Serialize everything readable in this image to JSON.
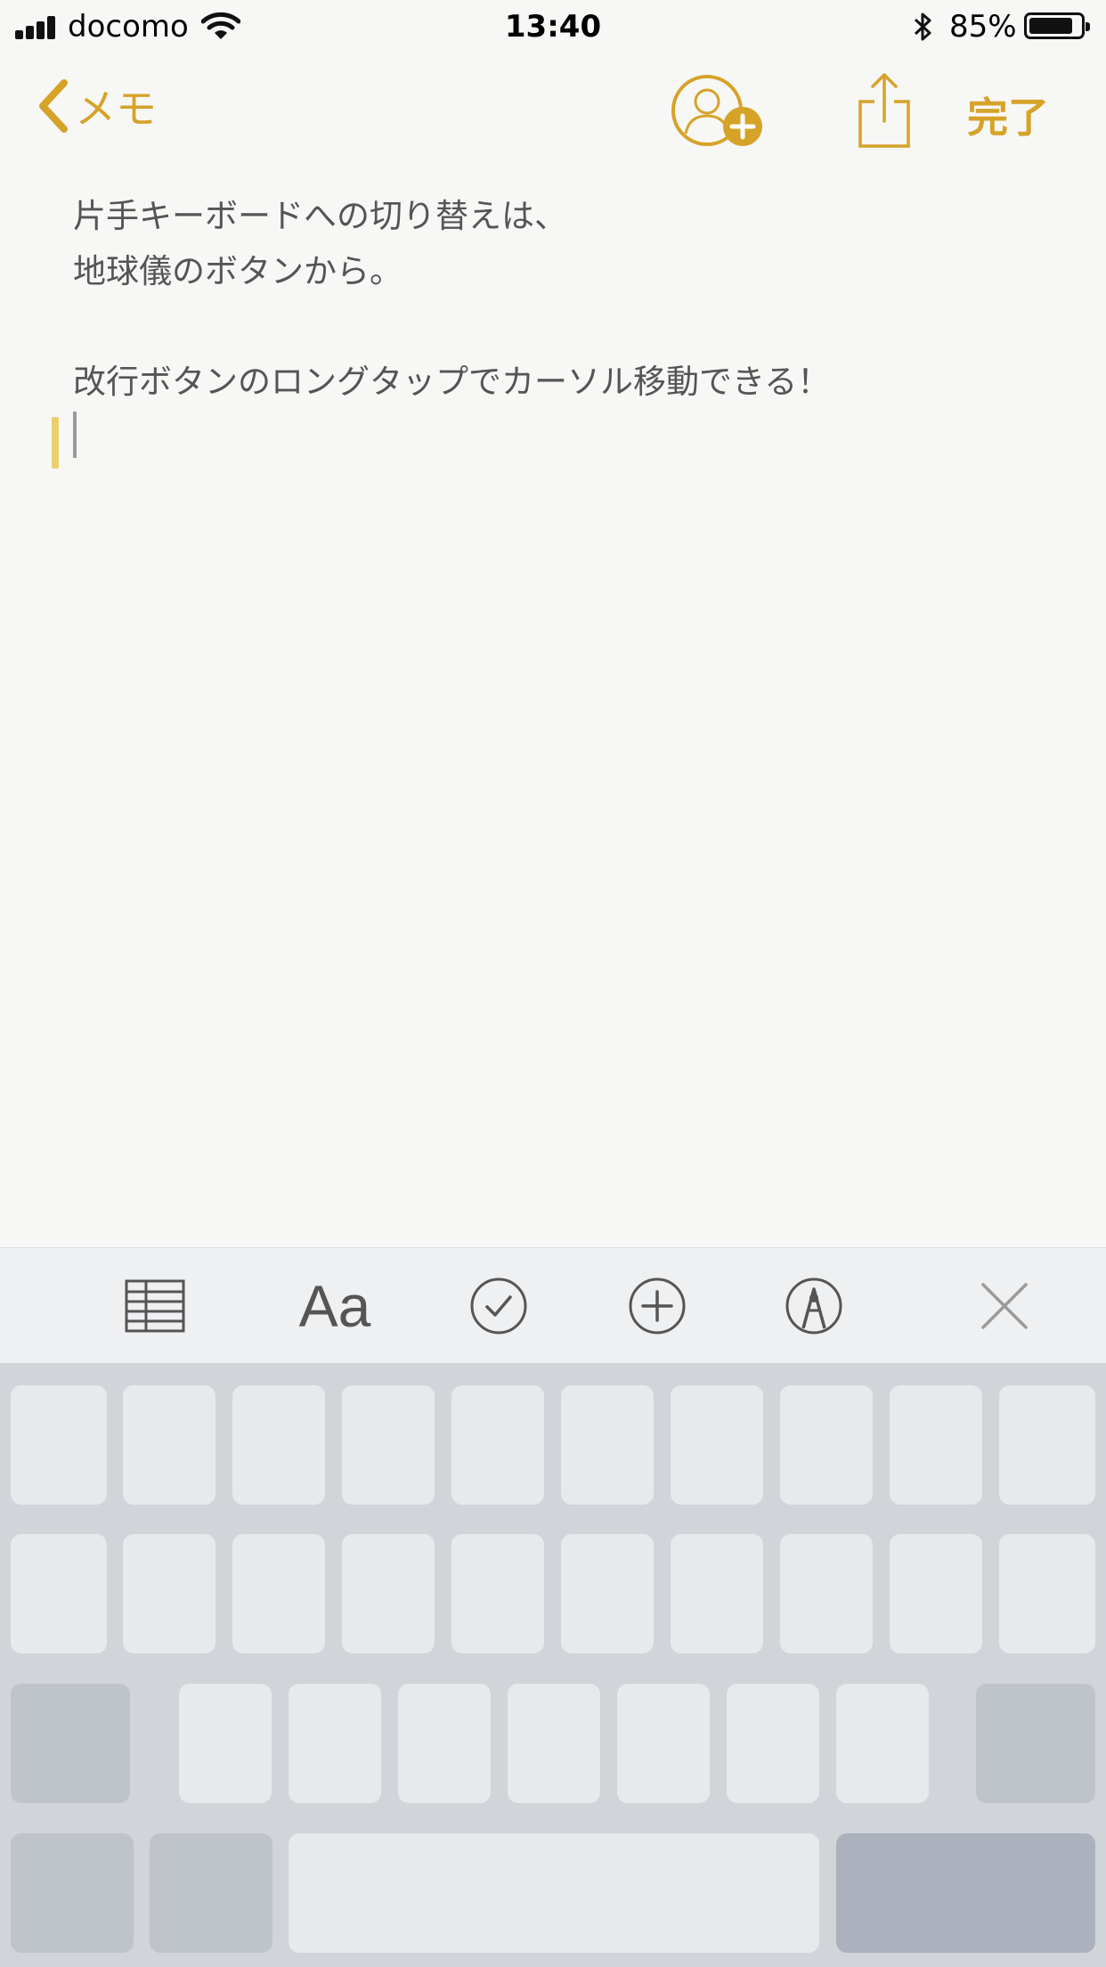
{
  "status_bar": {
    "carrier": "docomo",
    "time": "13:40",
    "battery_percent": "85%",
    "battery_level": 0.85
  },
  "nav": {
    "back_label": "メモ",
    "done_label": "完了"
  },
  "note": {
    "lines": [
      "片手キーボードへの切り替えは、",
      "地球儀のボタンから。",
      "",
      "改行ボタンのロングタップでカーソル移動できる！"
    ]
  },
  "toolbar": {
    "format_label": "Aa"
  },
  "colors": {
    "accent": "#d6a329",
    "page_background": "#f7f7f5",
    "toolbar_background": "#eef0f2",
    "keyboard_background": "#d1d4d9"
  }
}
